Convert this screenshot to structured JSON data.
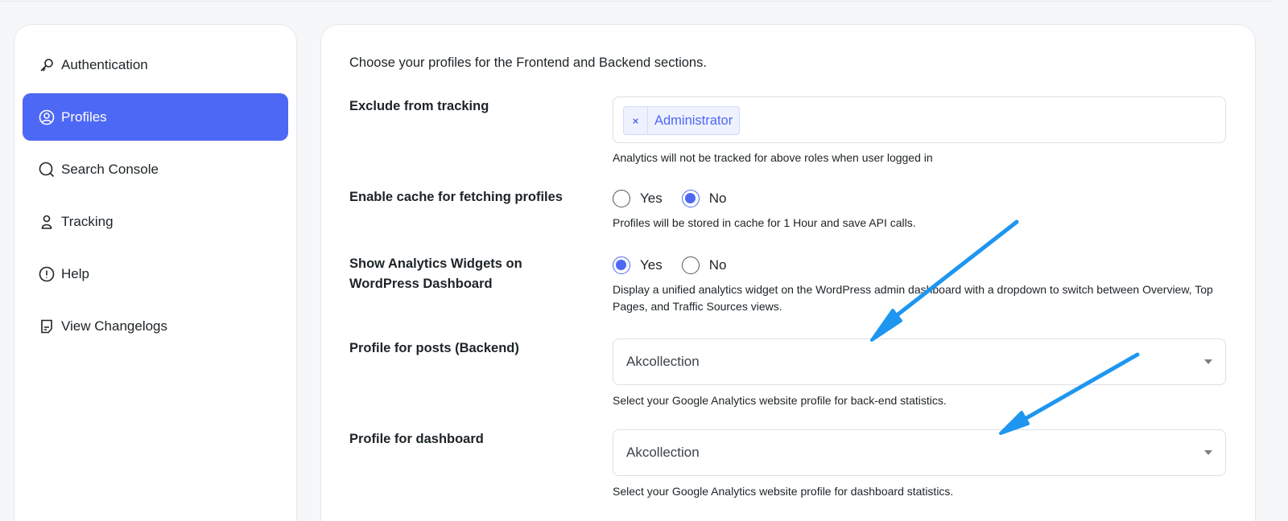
{
  "sidebar": {
    "items": [
      {
        "label": "Authentication",
        "icon": "key-icon",
        "active": false
      },
      {
        "label": "Profiles",
        "icon": "user-circle-icon",
        "active": true
      },
      {
        "label": "Search Console",
        "icon": "search-icon",
        "active": false
      },
      {
        "label": "Tracking",
        "icon": "person-icon",
        "active": false
      },
      {
        "label": "Help",
        "icon": "info-icon",
        "active": false
      },
      {
        "label": "View Changelogs",
        "icon": "document-icon",
        "active": false
      }
    ]
  },
  "main": {
    "intro": "Choose your profiles for the Frontend and Backend sections.",
    "exclude": {
      "label": "Exclude from tracking",
      "tag": "Administrator",
      "tag_remove": "×",
      "help": "Analytics will not be tracked for above roles when user logged in"
    },
    "cache": {
      "label": "Enable cache for fetching profiles",
      "yes": "Yes",
      "no": "No",
      "selected": "No",
      "help": "Profiles will be stored in cache for 1 Hour and save API calls."
    },
    "widgets": {
      "label": "Show Analytics Widgets on WordPress Dashboard",
      "yes": "Yes",
      "no": "No",
      "selected": "Yes",
      "help": "Display a unified analytics widget on the WordPress admin dashboard with a dropdown to switch between Overview, Top Pages, and Traffic Sources views."
    },
    "posts_profile": {
      "label": "Profile for posts (Backend)",
      "value": "Akcollection",
      "help": "Select your Google Analytics website profile for back-end statistics."
    },
    "dashboard_profile": {
      "label": "Profile for dashboard",
      "value": "Akcollection",
      "help": "Select your Google Analytics website profile for dashboard statistics."
    }
  },
  "colors": {
    "accent": "#4d68f5",
    "annotation_arrow": "#1e96f0"
  }
}
